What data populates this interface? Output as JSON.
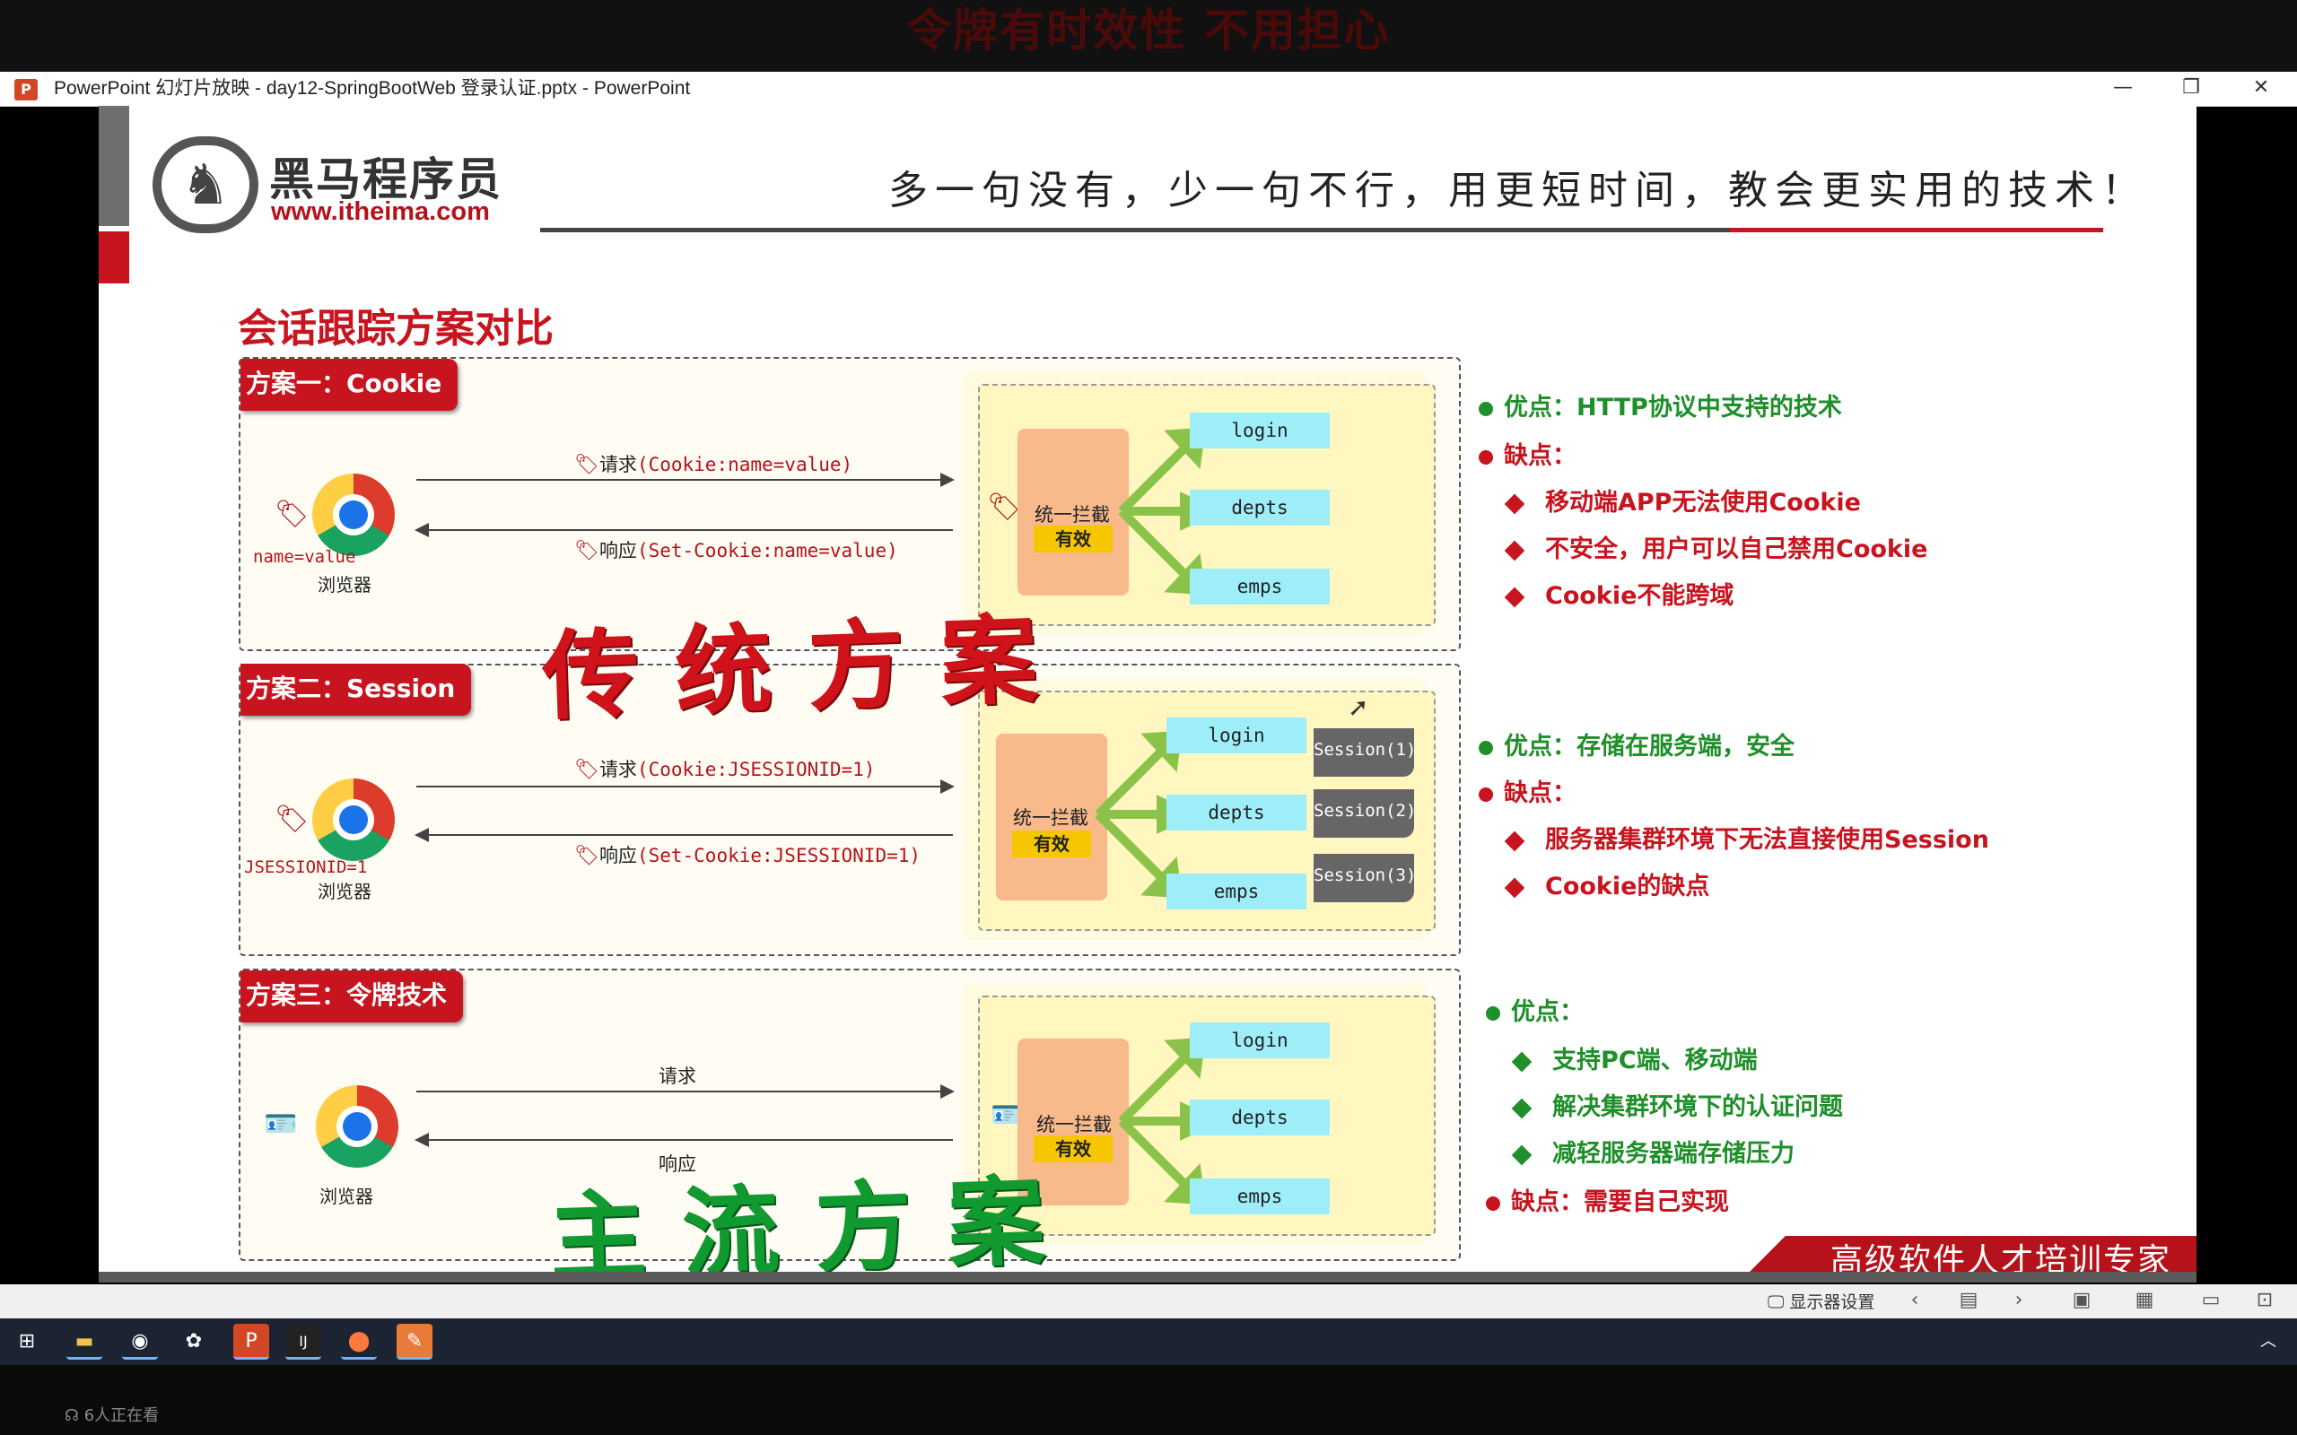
{
  "banner": {
    "text": "令牌有时效性  不用担心"
  },
  "window": {
    "title": "PowerPoint 幻灯片放映  -  day12-SpringBootWeb 登录认证.pptx - PowerPoint",
    "app_icon": "P",
    "minimize": "—",
    "restore": "❐",
    "close": "✕"
  },
  "logo": {
    "name": "黑马程序员",
    "url": "www.itheima.com",
    "icon": "horse-icon"
  },
  "slogan": "多一句没有，少一句不行，用更短时间，教会更实用的技术！",
  "slide_title": "会话跟踪方案对比",
  "plans": [
    {
      "label": "方案一：Cookie",
      "tag_text": "name=value",
      "browser": "浏览器",
      "request": {
        "prefix": "请求",
        "detail": "(Cookie:name=value)"
      },
      "response": {
        "prefix": "响应",
        "detail": "(Set-Cookie:name=value)"
      },
      "intercept": "统一拦截",
      "valid": "有效",
      "routes": [
        "login",
        "depts",
        "emps"
      ],
      "pros": [
        {
          "title": "优点：HTTP协议中支持的技术",
          "items": []
        }
      ],
      "cons_title": "缺点：",
      "cons": [
        "移动端APP无法使用Cookie",
        "不安全，用户可以自己禁用Cookie",
        "Cookie不能跨域"
      ]
    },
    {
      "label": "方案二：Session",
      "tag_text": "JSESSIONID=1",
      "browser": "浏览器",
      "request": {
        "prefix": "请求",
        "detail": "(Cookie:JSESSIONID=1)"
      },
      "response": {
        "prefix": "响应",
        "detail": "(Set-Cookie:JSESSIONID=1)"
      },
      "intercept": "统一拦截",
      "valid": "有效",
      "routes": [
        "login",
        "depts",
        "emps"
      ],
      "sessions": [
        "Session(1)",
        "Session(2)",
        "Session(3)"
      ],
      "pros": [
        {
          "title": "优点：存储在服务端，安全",
          "items": []
        }
      ],
      "cons_title": "缺点：",
      "cons": [
        "服务器集群环境下无法直接使用Session",
        "Cookie的缺点"
      ]
    },
    {
      "label": "方案三：令牌技术",
      "browser": "浏览器",
      "request": {
        "prefix": "请求"
      },
      "response": {
        "prefix": "响应"
      },
      "intercept": "统一拦截",
      "valid": "有效",
      "routes": [
        "login",
        "depts",
        "emps"
      ],
      "pros_title": "优点：",
      "pros_items": [
        "支持PC端、移动端",
        "解决集群环境下的认证问题",
        "减轻服务器端存储压力"
      ],
      "cons_title": "缺点：需要自己实现"
    }
  ],
  "overlays": {
    "traditional": "传统方案",
    "mainstream": "主流方案"
  },
  "footer": "高级软件人才培训专家",
  "showbar": {
    "display_settings": "显示器设置"
  },
  "taskbar": {
    "viewers": "6人正在看"
  },
  "colors": {
    "brand_red": "#c8141e",
    "green": "#1f8f2a",
    "route_blue": "#9eeefa",
    "intercept_orange": "#f8b98b",
    "valid_yellow": "#f6c600"
  }
}
